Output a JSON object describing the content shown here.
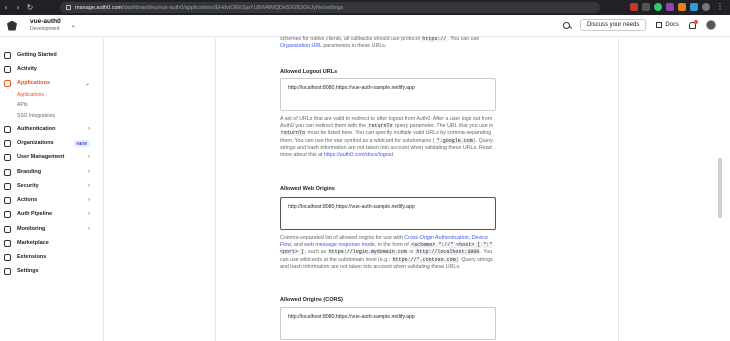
{
  "browser": {
    "url_host": "manage.auth0.com",
    "url_path": "/dashboard/eu/vue-auth0/applications/EHdvtOEKSjaYU8W4lMQDe50GB3GhJyNn/settings"
  },
  "header": {
    "tenant_name": "vue-auth0",
    "tenant_env": "Development",
    "discuss_label": "Discuss your needs",
    "docs_label": "Docs"
  },
  "sidebar": {
    "items": [
      {
        "label": "Getting Started",
        "icon": "rocket-icon"
      },
      {
        "label": "Activity",
        "icon": "activity-icon"
      },
      {
        "label": "Applications",
        "icon": "applications-icon"
      },
      {
        "label": "Authentication",
        "icon": "auth-icon"
      },
      {
        "label": "Organizations",
        "icon": "organizations-icon",
        "badge": "NEW"
      },
      {
        "label": "User Management",
        "icon": "users-icon"
      },
      {
        "label": "Branding",
        "icon": "branding-icon"
      },
      {
        "label": "Security",
        "icon": "shield-icon"
      },
      {
        "label": "Actions",
        "icon": "actions-icon"
      },
      {
        "label": "Auth Pipeline",
        "icon": "pipeline-icon"
      },
      {
        "label": "Monitoring",
        "icon": "monitoring-icon"
      },
      {
        "label": "Marketplace",
        "icon": "marketplace-icon"
      },
      {
        "label": "Extensions",
        "icon": "extensions-icon"
      },
      {
        "label": "Settings",
        "icon": "gear-icon"
      }
    ],
    "sub_items": [
      "Applications",
      "APIs",
      "SSO Integrations"
    ]
  },
  "content": {
    "top_text_1": "schemes for native clients, all callbacks should use protocol",
    "top_code": "https://",
    "top_text_2": ". You can use",
    "top_link": "Organization URL",
    "top_text_3": "parameters in these URLs.",
    "logout_label": "Allowed Logout URLs",
    "logout_value": "http://localhost:8080,https://vue-auth-sample.netlify.app",
    "logout_help_1": "A set of URLs that are valid to redirect to after logout from Auth0. After a user logs out from Auth0 you can redirect them with the",
    "logout_code_1": "returnTo",
    "logout_help_2": "query parameter. The URL that you use in",
    "logout_code_2": "returnTo",
    "logout_help_3": "must be listed here. You can specify multiple valid URLs by comma-separating them. You can use the star symbol as a wildcard for subdomains (",
    "logout_code_3": "*.google.com",
    "logout_help_4": "). Query strings and hash information are not taken into account when validating these URLs. Read more about this at",
    "logout_link": "https://auth0.com/docs/logout",
    "web_origins_label": "Allowed Web Origins",
    "web_origins_value": "http://localhost:8080,https://vue-auth-sample.netlify.app",
    "web_help_1": "Comma-separated list of allowed origins for use with",
    "web_link_1": "Cross-Origin Authentication",
    "web_help_sep": ",",
    "web_link_2": "Device Flow",
    "web_help_2": ", and",
    "web_link_3": "web message response mode",
    "web_help_3": ", in the form of",
    "web_code_1": "<scheme> \"://\" <host> [ \":\" <port> ]",
    "web_help_4": ", such as",
    "web_code_2": "https://login.mydomain.com",
    "web_help_5": "or",
    "web_code_3": "http://localhost:3000",
    "web_help_6": ". You can use wildcards at the subdomain level (e.g.:",
    "web_code_4": "https://*.contoso.com",
    "web_help_7": "). Query strings and hash information are not taken into account when validating these URLs.",
    "cors_label": "Allowed Origins (CORS)",
    "cors_value": "http://localhost:8080,https://vue-auth-sample.netlify.app"
  },
  "colors": {
    "accent": "#eb5424",
    "link": "#3f59e4"
  }
}
